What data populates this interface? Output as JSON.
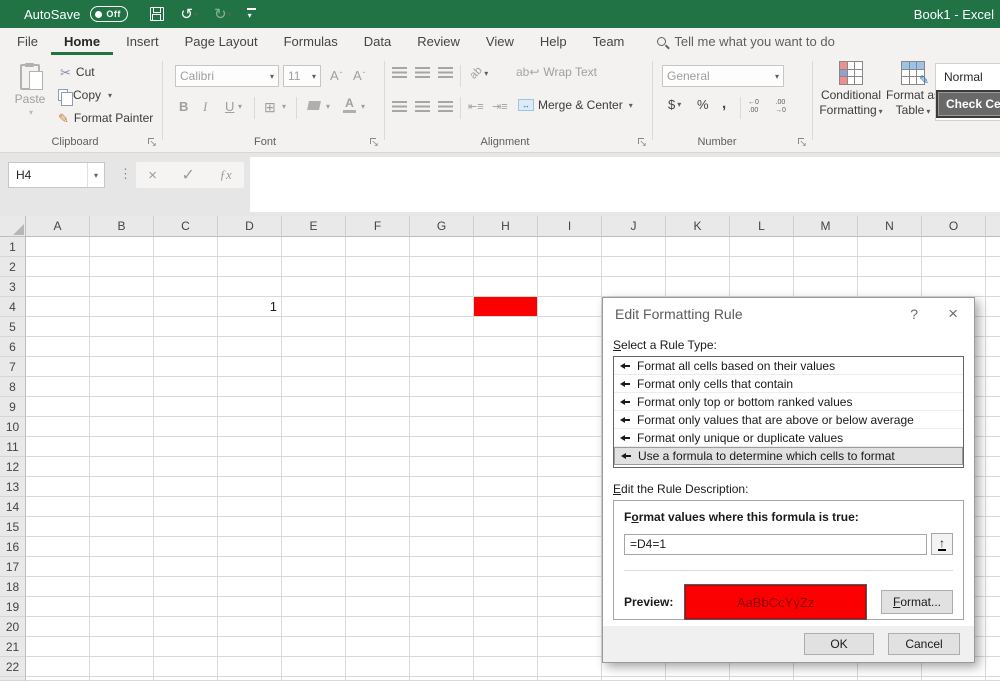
{
  "titlebar": {
    "autosave_label": "AutoSave",
    "autosave_state": "Off",
    "workbook_title": "Book1 - Excel"
  },
  "tabs": {
    "items": [
      {
        "label": "File",
        "active": false
      },
      {
        "label": "Home",
        "active": true
      },
      {
        "label": "Insert",
        "active": false
      },
      {
        "label": "Page Layout",
        "active": false
      },
      {
        "label": "Formulas",
        "active": false
      },
      {
        "label": "Data",
        "active": false
      },
      {
        "label": "Review",
        "active": false
      },
      {
        "label": "View",
        "active": false
      },
      {
        "label": "Help",
        "active": false
      },
      {
        "label": "Team",
        "active": false
      }
    ],
    "search_placeholder": "Tell me what you want to do"
  },
  "ribbon": {
    "clipboard": {
      "group_label": "Clipboard",
      "paste_label": "Paste",
      "cut_label": "Cut",
      "copy_label": "Copy",
      "format_painter_label": "Format Painter"
    },
    "font": {
      "group_label": "Font",
      "font_name": "Calibri",
      "font_size": "11",
      "bold_label": "B",
      "italic_label": "I",
      "underline_label": "U",
      "grow_font_label": "A",
      "shrink_font_label": "A",
      "font_color_label": "A"
    },
    "alignment": {
      "group_label": "Alignment",
      "wrap_text_label": "Wrap Text",
      "merge_center_label": "Merge & Center",
      "orientation_label": "ab"
    },
    "number": {
      "group_label": "Number",
      "format_value": "General",
      "currency_label": "$",
      "percent_label": "%",
      "comma_label": ",",
      "increase_decimal_label": "←0\n.00",
      "decrease_decimal_label": ".00\n→0"
    },
    "styles": {
      "conditional_line1": "Conditional",
      "conditional_line2": "Formatting",
      "format_table_line1": "Format as",
      "format_table_line2": "Table",
      "gallery": [
        {
          "name": "Normal",
          "selected": false
        },
        {
          "name": "Check Ce",
          "selected": true
        }
      ]
    }
  },
  "formula_bar": {
    "name_box_value": "H4",
    "cancel_glyph": "×",
    "enter_glyph": "✓",
    "fx_label": "ƒx",
    "formula_value": ""
  },
  "grid": {
    "column_headers": [
      "A",
      "B",
      "C",
      "D",
      "E",
      "F",
      "G",
      "H",
      "I",
      "J",
      "K",
      "L",
      "M",
      "N",
      "O"
    ],
    "row_count": 22,
    "cells": [
      {
        "ref": "D4",
        "col": "D",
        "row": 4,
        "value": "1"
      },
      {
        "ref": "H4",
        "col": "H",
        "row": 4,
        "value": "",
        "fill": "#fb0000"
      }
    ],
    "active_cell": "H4"
  },
  "dialog": {
    "title": "Edit Formatting Rule",
    "help_label": "?",
    "close_label": "×",
    "rule_type_label": {
      "pre": "",
      "key": "S",
      "rest": "elect a Rule Type:"
    },
    "rule_types": [
      "Format all cells based on their values",
      "Format only cells that contain",
      "Format only top or bottom ranked values",
      "Format only values that are above or below average",
      "Format only unique or duplicate values",
      "Use a formula to determine which cells to format"
    ],
    "selected_rule_index": 5,
    "description_label": {
      "pre": "",
      "key": "E",
      "rest": "dit the Rule Description:"
    },
    "formula_prompt": {
      "pre": "F",
      "key": "o",
      "rest": "rmat values where this formula is true:"
    },
    "formula_value": "=D4=1",
    "collapse_glyph": "↑",
    "preview_label": "Preview:",
    "preview_text": "AaBbCcYyZz",
    "preview_fill": "#fb0000",
    "preview_text_color": "#8b0000",
    "format_button": {
      "pre": "",
      "key": "F",
      "rest": "ormat..."
    },
    "ok_label": "OK",
    "cancel_label": "Cancel"
  },
  "colors": {
    "brand_green": "#217346",
    "cell_fill_red": "#fb0000"
  }
}
